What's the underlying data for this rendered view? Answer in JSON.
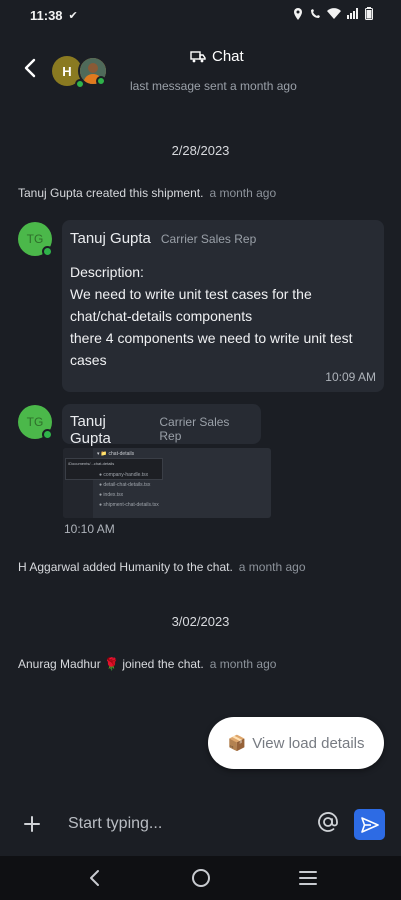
{
  "status_bar": {
    "time": "11:38"
  },
  "header": {
    "title": "Chat",
    "subtitle": "last message sent a month ago",
    "avatar_initial": "H"
  },
  "colors": {
    "background": "#1b1e24",
    "bubble": "#272b33",
    "online": "#2fb34a",
    "send": "#2d6be4",
    "avatar_green": "#4bb84a"
  },
  "date_separators": [
    "2/28/2023",
    "3/02/2023"
  ],
  "events": [
    {
      "text": "Tanuj Gupta created this shipment.",
      "ago": "a month ago"
    },
    {
      "text": "H Aggarwal added Humanity to the chat.",
      "ago": "a month ago"
    },
    {
      "text": "Anurag Madhur 🌹 joined the chat.",
      "ago": "a month ago"
    }
  ],
  "messages": [
    {
      "initials": "TG",
      "sender": "Tanuj Gupta",
      "role": "Carrier Sales Rep",
      "lines": [
        "Description:",
        "We need to write unit test cases for the",
        "chat/chat-details components",
        "there 4 components we need to write unit test",
        "cases"
      ],
      "time": "10:09 AM"
    },
    {
      "initials": "TG",
      "sender": "Tanuj Gupta",
      "role": "Carrier Sales Rep",
      "time": "10:10 AM",
      "attachment": {
        "folder": "chat-details",
        "tooltip": "/Documents/...chat-details",
        "files": [
          "company-handle.tsx",
          "detail-chat-details.tsx",
          "index.tsx",
          "shipment-chat-details.tsx"
        ]
      }
    }
  ],
  "fab": {
    "icon": "📦",
    "label": "View load details"
  },
  "composer": {
    "placeholder": "Start typing...",
    "value": ""
  }
}
